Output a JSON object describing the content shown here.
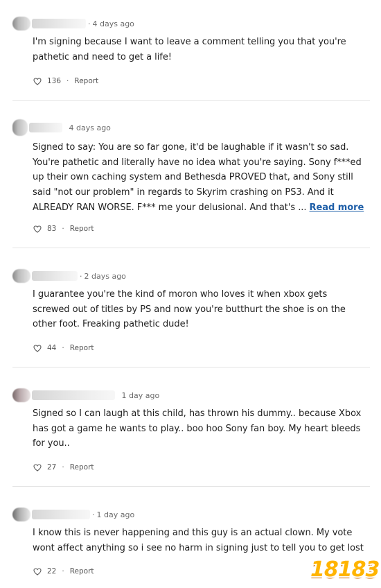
{
  "comments": [
    {
      "time": "4 days ago",
      "lines": [
        "I'm signing because I want to leave a comment telling you that you're",
        "pathetic and need to get a life!"
      ],
      "likes": "136",
      "report": "Report"
    },
    {
      "time": "4 days ago",
      "lines": [
        "Signed to say: You are so far gone, it'd be laughable if it wasn't so sad.",
        "You're pathetic and literally have no idea what you're saying. Sony f***ed",
        "up their own caching system and Bethesda PROVED that, and Sony still",
        "said \"not our problem\" in regards to Skyrim crashing on PS3. And it",
        "ALREADY RAN WORSE. F*** me your delusional. And that's ..."
      ],
      "read_more": "Read more",
      "likes": "83",
      "report": "Report"
    },
    {
      "time": "2 days ago",
      "lines": [
        "I guarantee you're the kind of moron who loves it when xbox gets",
        "screwed out of titles by PS and now you're butthurt the shoe is on the",
        "other foot. Freaking pathetic dude!"
      ],
      "likes": "44",
      "report": "Report"
    },
    {
      "time": "1 day ago",
      "lines": [
        "Signed so I can laugh at this child, has thrown his dummy.. because Xbox",
        "has got a game he wants to play.. boo hoo Sony fan boy. My heart bleeds",
        "for you.."
      ],
      "likes": "27",
      "report": "Report"
    },
    {
      "time": "1 day ago",
      "lines": [
        "I know this is never happening and this guy is an actual clown. My vote",
        "wont affect anything so i see no harm in signing just to tell you to get lost"
      ],
      "likes": "22",
      "report": "Report"
    }
  ],
  "watermark": {
    "text": "18183",
    "color": "#ffb400"
  },
  "icons": {
    "like": "heart-outline-icon"
  },
  "colors": {
    "link": "#1f5fa8",
    "meta": "#6b6b6b",
    "divider": "#e4e4e4"
  }
}
